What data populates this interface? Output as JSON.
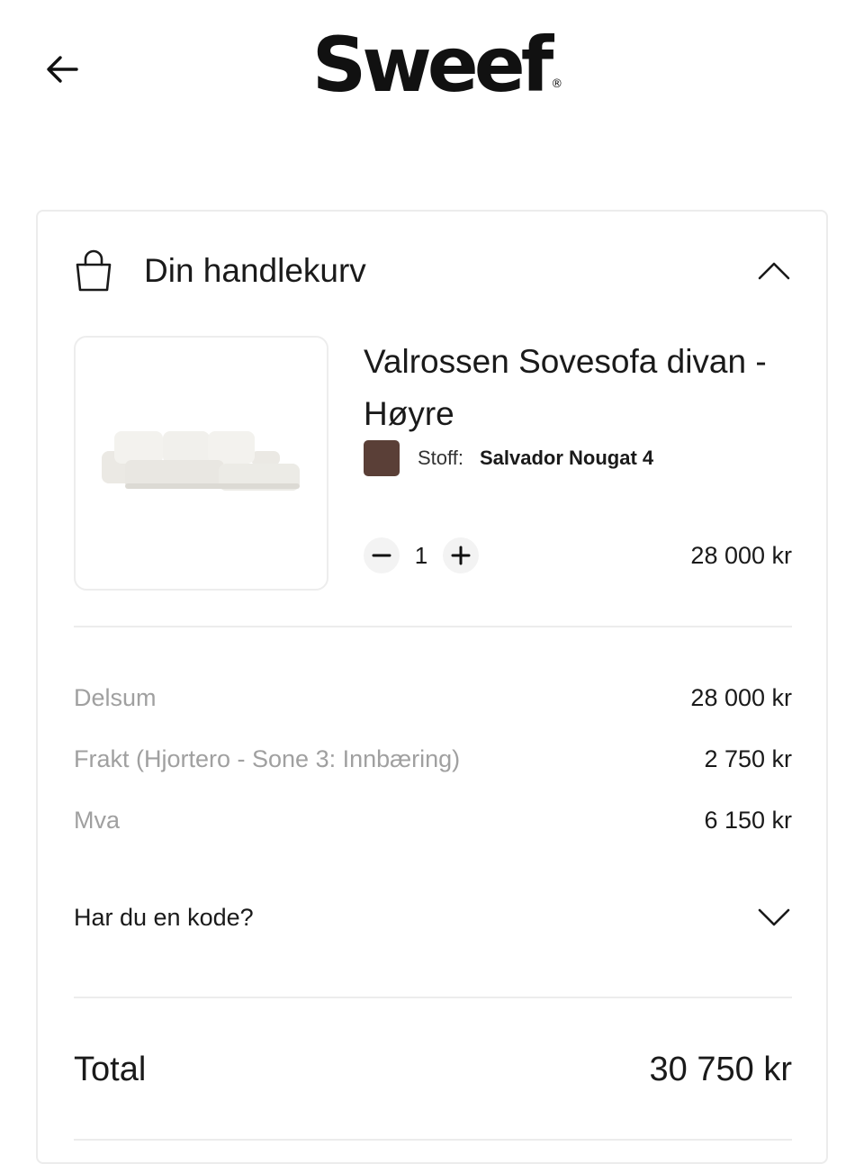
{
  "brand": {
    "logo_text": "Sweef",
    "registered_mark": "®"
  },
  "icons": {
    "back": "arrow-left-icon",
    "bag": "shopping-bag-icon",
    "collapse": "chevron-up-icon",
    "expand": "chevron-down-icon",
    "minus": "minus-icon",
    "plus": "plus-icon"
  },
  "cart": {
    "title": "Din handlekurv",
    "item": {
      "name": "Valrossen Sovesofa divan - Høyre",
      "fabric_label": "Stoff:",
      "fabric_value": "Salvador Nougat 4",
      "swatch_color": "#5a3f37",
      "quantity": "1",
      "price": "28 000 kr"
    },
    "summary": [
      {
        "label": "Delsum",
        "value": "28 000 kr"
      },
      {
        "label": "Frakt (Hjortero - Sone 3: Innbæring)",
        "value": "2 750 kr"
      },
      {
        "label": "Mva",
        "value": "6 150 kr"
      }
    ],
    "discount_prompt": "Har du en kode?",
    "total_label": "Total",
    "total_value": "30 750 kr"
  }
}
